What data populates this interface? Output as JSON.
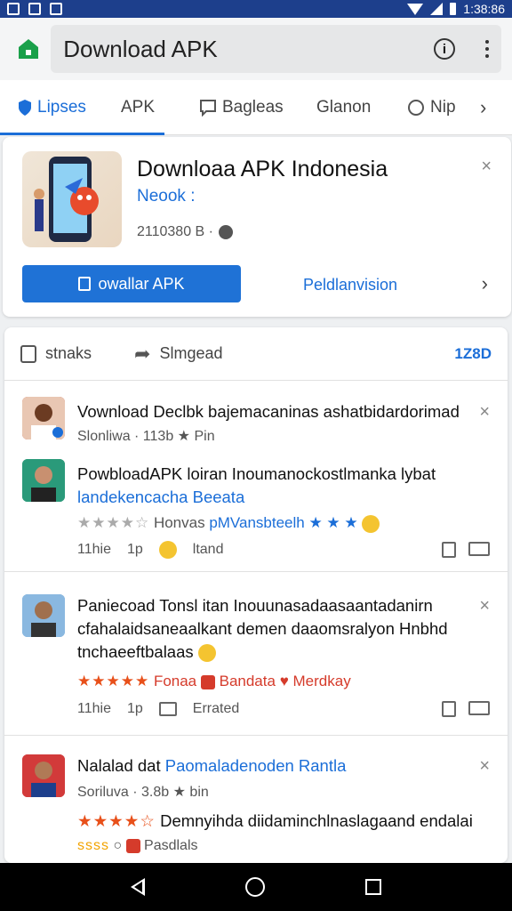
{
  "status_bar": {
    "time": "1:38:86"
  },
  "app_bar": {
    "title": "Download APK"
  },
  "tabs": [
    {
      "label": "Lipses",
      "active": true
    },
    {
      "label": "APK"
    },
    {
      "label": "Bagleas"
    },
    {
      "label": "Glanon"
    },
    {
      "label": "Nip"
    }
  ],
  "app_card": {
    "title": "Downloaa APK Indonesia",
    "developer": "Neook :",
    "meta": "2110380 B ·",
    "download_label": "owallar APK",
    "permissions_label": "Peldlanvision"
  },
  "feed_header": {
    "like_label": "stnaks",
    "share_label": "Slmgead",
    "count": "1Z8D"
  },
  "posts": [
    {
      "title": "Vownload Declbk bajemacaninas ashatbidardorimad",
      "sub": "Slonliwa · 113b",
      "sub_extra": "Pin"
    },
    {
      "line1": "PowbloadAPK loiran  Inoumanockostlmanka lybat",
      "line2": "landekencacha Beeata",
      "tags_a": "Honvas",
      "tags_b": "pMVansbteelh",
      "stats": "11hie",
      "stat2": "1p",
      "stat3": "ltand"
    },
    {
      "line1": "Paniecoad Tonsl itan  Inouunasadaasaantadanirn",
      "line2": "cfahalaidsaneaalkant demen daaomsralyon Hnbhd",
      "line3": "tnchaeeftbalaas",
      "tag1": "Fonaa",
      "tag2": "Bandata",
      "tag3": "Merdkay",
      "stats": "11hie",
      "stat2": "1p",
      "stat3": "Errated"
    },
    {
      "title_a": "Nalalad dat",
      "title_b": "Paomaladenoden Rantla",
      "sub": "Soriluva · 3.8b",
      "sub_extra": "bin",
      "line2": "Demnyihda diidaminchlnaslagaand endalai",
      "line3_a": "ssss",
      "line3_b": "Pasdlals"
    }
  ]
}
